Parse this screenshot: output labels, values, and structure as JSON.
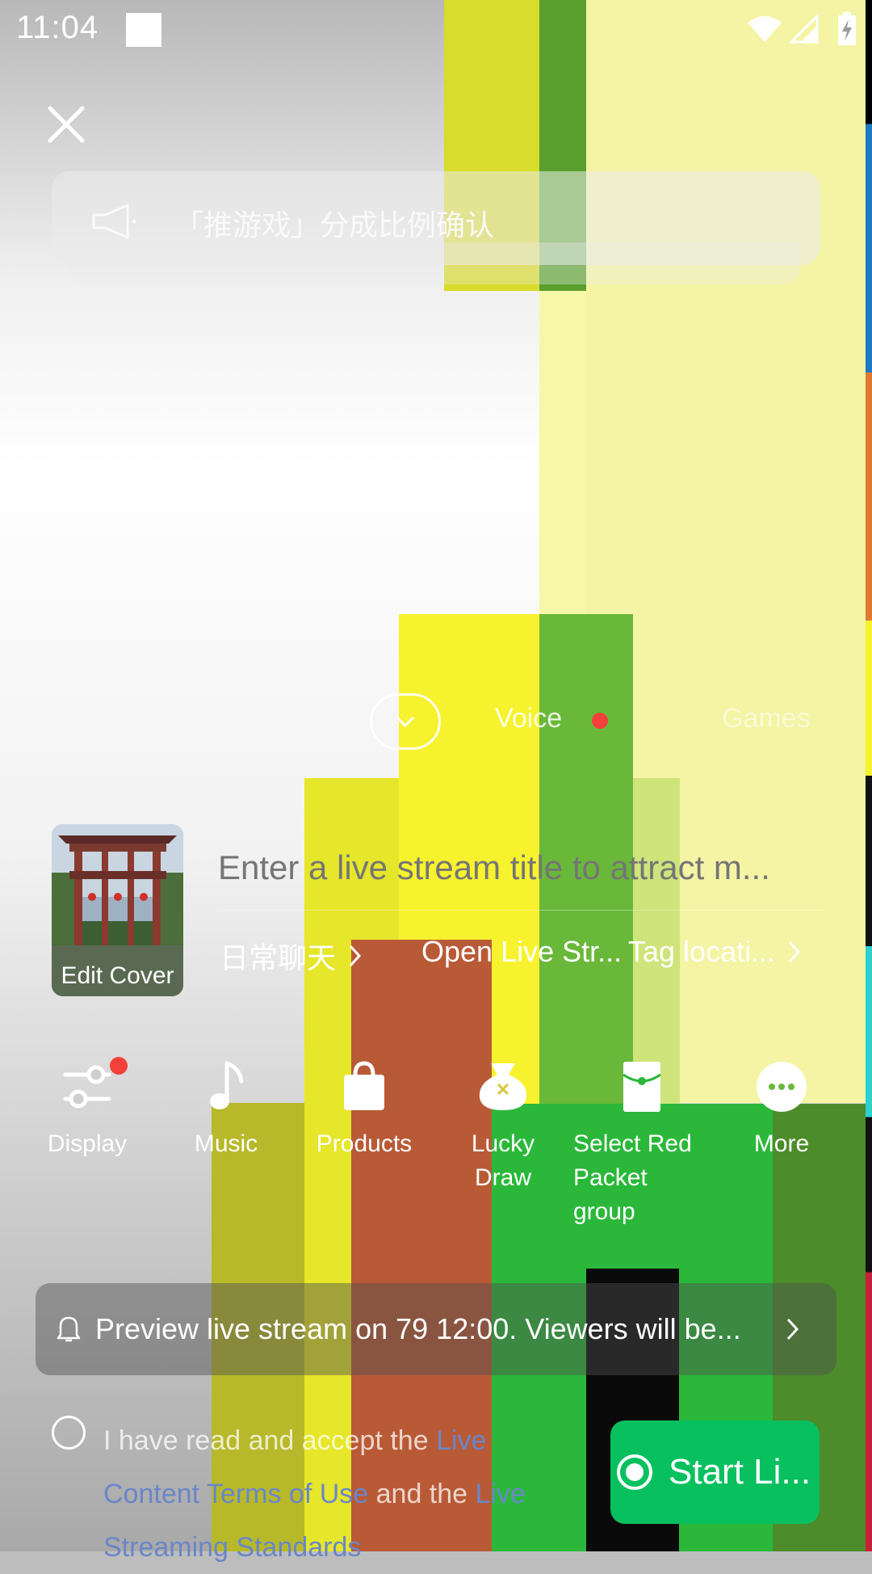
{
  "status_bar": {
    "time": "11:04"
  },
  "notice": {
    "text": "「推游戏」分成比例确认"
  },
  "modes": {
    "voice": "Voice",
    "games": "Games"
  },
  "title_input": {
    "placeholder": "Enter a live stream title to attract m..."
  },
  "cover": {
    "label": "Edit Cover"
  },
  "meta_row": {
    "category": "日常聊天",
    "open_live": "Open Live Str...",
    "tag_location": "Tag locati..."
  },
  "tools": [
    {
      "label": "Display",
      "icon": "sliders-icon"
    },
    {
      "label": "Music",
      "icon": "music-note-icon"
    },
    {
      "label": "Products",
      "icon": "shopping-bag-icon"
    },
    {
      "label": "Lucky Draw",
      "icon": "lucky-bag-icon"
    },
    {
      "label": "Select Red Packet group",
      "icon": "red-packet-icon"
    },
    {
      "label": "More",
      "icon": "more-dots-icon"
    }
  ],
  "preview": {
    "text": "Preview live stream on 79 12:00. Viewers will be..."
  },
  "agreement": {
    "prefix": "I have read and accept the ",
    "link1": "Live Content Terms of Use",
    "mid": " and the ",
    "link2": "Live Streaming Standards"
  },
  "start_button": {
    "label": "Start Li..."
  },
  "colors": {
    "start_green": "#09c05f",
    "badge_red": "#f4403a",
    "link_blue": "#6a86c9"
  }
}
